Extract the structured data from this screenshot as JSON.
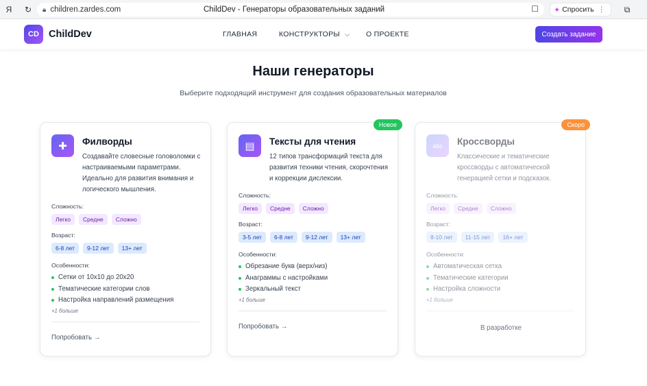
{
  "browser": {
    "url": "children.zardes.com",
    "tab_title": "ChildDev - Генераторы образовательных заданий",
    "ask_label": "Спросить"
  },
  "header": {
    "logo_abbr": "CD",
    "logo_name": "ChildDev",
    "nav": {
      "home": "ГЛАВНАЯ",
      "constructors": "КОНСТРУКТОРЫ",
      "about": "О ПРОЕКТЕ"
    },
    "create_button": "Создать задание"
  },
  "hero": {
    "title": "Наши генераторы",
    "subtitle": "Выберите подходящий инструмент для создания образовательных материалов"
  },
  "labels": {
    "difficulty": "Сложность:",
    "age": "Возраст:",
    "features": "Особенности:"
  },
  "cards": [
    {
      "title": "Филворды",
      "description": "Создавайте словесные головоломки с настраиваемыми параметрами. Идеально для развития внимания и логического мышления.",
      "difficulty": [
        "Легко",
        "Средне",
        "Сложно"
      ],
      "ages": [
        "6-8 лет",
        "9-12 лет",
        "13+ лет"
      ],
      "features": [
        "Сетки от 10x10 до 20x20",
        "Тематические категории слов",
        "Настройка направлений размещения"
      ],
      "more": "+1 больше",
      "action": "Попробовать →"
    },
    {
      "badge": "Новое",
      "title": "Тексты для чтения",
      "description": "12 типов трансформаций текста для развития техники чтения, скорочтения и коррекции дислексии.",
      "difficulty": [
        "Легко",
        "Средне",
        "Сложно"
      ],
      "ages": [
        "3-5 лет",
        "6-8 лет",
        "9-12 лет",
        "13+ лет"
      ],
      "features": [
        "Обрезание букв (верх/низ)",
        "Анаграммы с настройками",
        "Зеркальный текст"
      ],
      "more": "+1 больше",
      "action": "Попробовать →"
    },
    {
      "badge": "Скоро",
      "title": "Кроссворды",
      "description": "Классические и тематические кроссворды с автоматической генерацией сетки и подсказок.",
      "difficulty": [
        "Легко",
        "Средне",
        "Сложно"
      ],
      "ages": [
        "8-10 лет",
        "11-15 лет",
        "16+ лет"
      ],
      "features": [
        "Автоматическая сетка",
        "Тематические категории",
        "Настройка сложности"
      ],
      "more": "+1 больше",
      "action": "В разработке"
    }
  ]
}
